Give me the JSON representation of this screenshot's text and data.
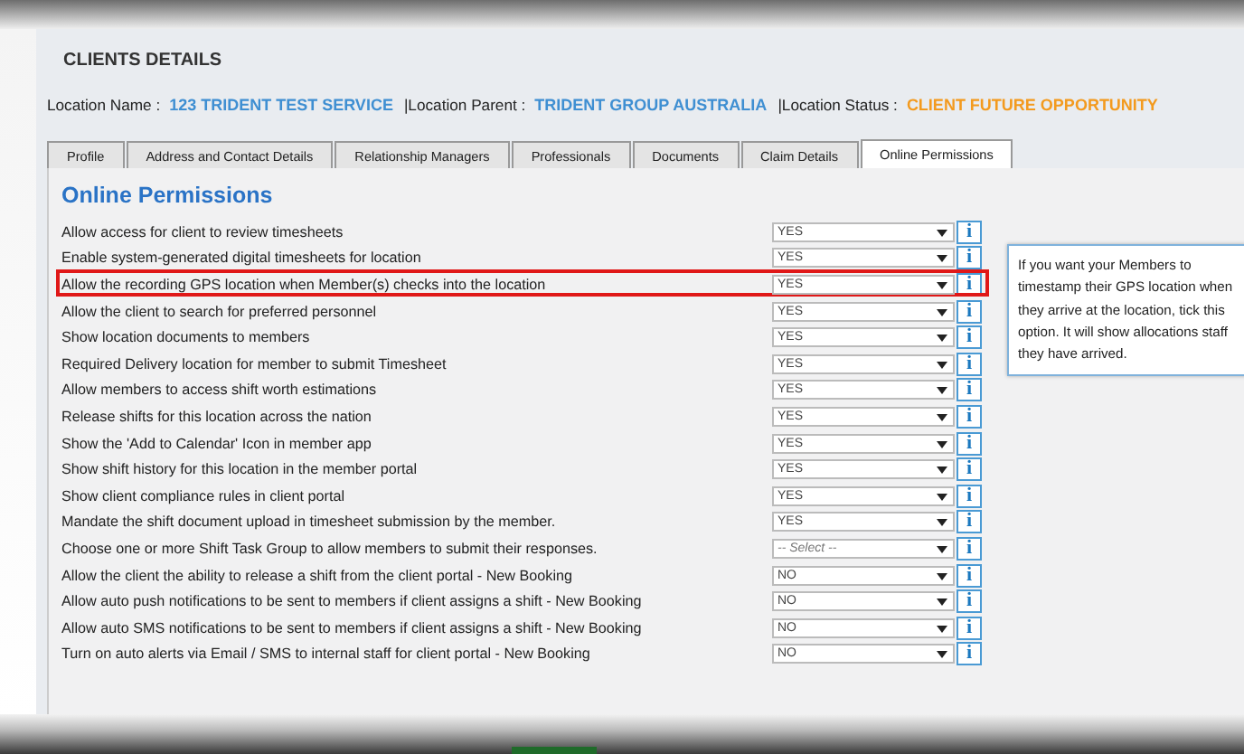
{
  "page_title": "CLIENTS DETAILS",
  "location_fields": [
    {
      "label": "Location Name :",
      "value": "123 TRIDENT TEST SERVICE",
      "color": "#3f8fd2"
    },
    {
      "label": "|Location Parent :",
      "value": "TRIDENT GROUP AUSTRALIA",
      "color": "#3f8fd2"
    },
    {
      "label": "|Location Status :",
      "value": "CLIENT FUTURE OPPORTUNITY",
      "color": "#f39a1e"
    }
  ],
  "tabs": [
    {
      "label": "Profile",
      "selected": false
    },
    {
      "label": "Address and Contact Details",
      "selected": false
    },
    {
      "label": "Relationship Managers",
      "selected": false
    },
    {
      "label": "Professionals",
      "selected": false
    },
    {
      "label": "Documents",
      "selected": false
    },
    {
      "label": "Claim Details",
      "selected": false
    },
    {
      "label": "Online Permissions",
      "selected": true
    }
  ],
  "section_title": "Online Permissions",
  "permissions": [
    {
      "label": "Allow access for client to review timesheets",
      "value": "YES",
      "info_button": "i",
      "highlighted": false
    },
    {
      "label": "Enable system-generated digital timesheets for location",
      "value": "YES",
      "info_button": "i",
      "highlighted": false
    },
    {
      "label": "Allow the recording GPS location when Member(s) checks into the location",
      "value": "YES",
      "info_button": "i",
      "highlighted": true
    },
    {
      "label": "Allow the client to search for preferred personnel",
      "value": "YES",
      "info_button": "i",
      "highlighted": false
    },
    {
      "label": "Show location documents to members",
      "value": "YES",
      "info_button": "i",
      "highlighted": false
    },
    {
      "label": "Required Delivery location for member to submit Timesheet",
      "value": "YES",
      "info_button": "i",
      "highlighted": false
    },
    {
      "label": "Allow members to access shift worth estimations",
      "value": "YES",
      "info_button": "i",
      "highlighted": false
    },
    {
      "label": "Release shifts for this location across the nation",
      "value": "YES",
      "info_button": "i",
      "highlighted": false
    },
    {
      "label": "Show the 'Add to Calendar' Icon in member app",
      "value": "YES",
      "info_button": "i",
      "highlighted": false
    },
    {
      "label": "Show shift history for this location in the member portal",
      "value": "YES",
      "info_button": "i",
      "highlighted": false
    },
    {
      "label": "Show client compliance rules in client portal",
      "value": "YES",
      "info_button": "i",
      "highlighted": false
    },
    {
      "label": "Mandate the shift document upload in timesheet submission by the member.",
      "value": "YES",
      "info_button": "i",
      "highlighted": false
    },
    {
      "label": "Choose one or more Shift Task Group to allow members to submit their responses.",
      "placeholder": "-- Select --",
      "info_button": "i",
      "highlighted": false
    },
    {
      "label": "Allow the client the ability to release a shift from the client portal - New Booking",
      "value": "NO",
      "info_button": "i",
      "highlighted": false
    },
    {
      "label": "Allow auto push notifications to be sent to members if client assigns a shift - New Booking",
      "value": "NO",
      "info_button": "i",
      "highlighted": false
    },
    {
      "label": "Allow auto SMS notifications to be sent to members if client assigns a shift - New Booking",
      "value": "NO",
      "info_button": "i",
      "highlighted": false
    },
    {
      "label": "Turn on auto alerts via Email / SMS to internal staff for client portal - New Booking",
      "value": "NO",
      "info_button": "i",
      "highlighted": false
    }
  ],
  "tooltip": {
    "text": "If you want your Members to timestamp their GPS location when they arrive at the location, tick this option. It will show allocations staff they have arrived."
  }
}
